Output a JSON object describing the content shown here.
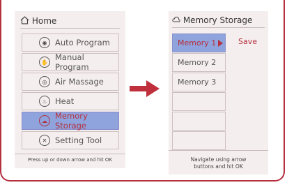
{
  "left_screen": {
    "header": {
      "title": "Home",
      "icon": "home-icon"
    },
    "menu": [
      {
        "label": "Auto Program",
        "icon": "auto-program-icon",
        "glyph": "◉"
      },
      {
        "label": "Manual Program",
        "icon": "hand-icon",
        "glyph": "✋"
      },
      {
        "label": "Air Massage",
        "icon": "air-massage-icon",
        "glyph": "◎"
      },
      {
        "label": "Heat",
        "icon": "heat-icon",
        "glyph": "♨"
      },
      {
        "label": "Memory Storage",
        "icon": "memory-storage-icon",
        "glyph": "☁",
        "selected": true
      },
      {
        "label": "Setting Tool",
        "icon": "setting-tool-icon",
        "glyph": "✕"
      }
    ],
    "footnote": "Press up or down arrow and hit OK"
  },
  "right_screen": {
    "header": {
      "title": "Memory Storage",
      "icon": "memory-storage-icon"
    },
    "memories": [
      "Memory 1",
      "Memory 2",
      "Memory 3",
      "",
      "",
      ""
    ],
    "selected_index": 0,
    "save_label": "Save",
    "hint_line1": "Navigate using arrow",
    "hint_line2": "buttons and hit OK"
  },
  "colors": {
    "accent": "#b5313f",
    "selection": "#8fa3dd",
    "screen_bg": "#f5eeee"
  }
}
